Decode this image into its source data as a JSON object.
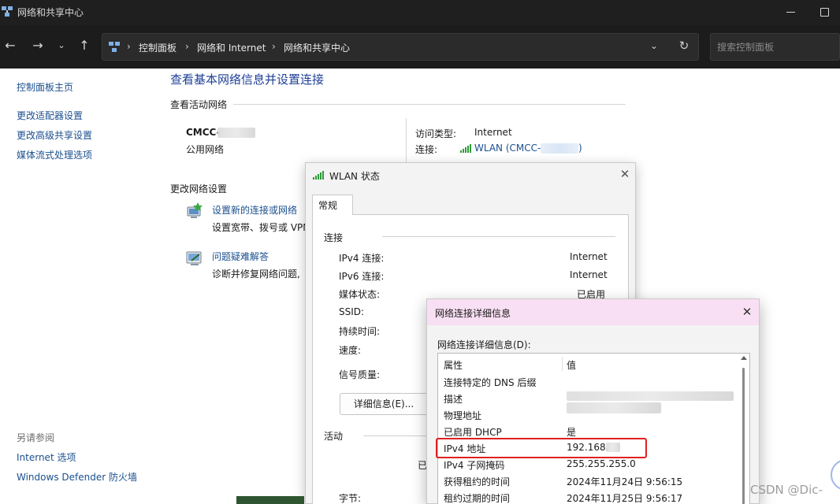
{
  "window": {
    "title": "网络和共享中心"
  },
  "address_bar": {
    "crumbs": [
      "控制面板",
      "网络和 Internet",
      "网络和共享中心"
    ],
    "search_placeholder": "搜索控制面板"
  },
  "sidebar": {
    "links": [
      "控制面板主页",
      "更改适配器设置",
      "更改高级共享设置",
      "媒体流式处理选项"
    ],
    "see_also_title": "另请参阅",
    "see_also_links": [
      "Internet 选项",
      "Windows Defender 防火墙"
    ]
  },
  "main": {
    "title": "查看基本网络信息并设置连接",
    "active_networks_label": "查看活动网络",
    "network_name": "CMCC-",
    "network_type": "公用网络",
    "access_type_label": "访问类型:",
    "access_type_value": "Internet",
    "connections_label": "连接:",
    "connection_link": "WLAN (CMCC-",
    "connection_link_end": ")",
    "change_settings_label": "更改网络设置",
    "tasks": [
      {
        "title": "设置新的连接或网络",
        "desc": "设置宽带、拨号或 VPN"
      },
      {
        "title": "问题疑难解答",
        "desc": "诊断并修复网络问题,"
      }
    ]
  },
  "wlan_dialog": {
    "title": "WLAN 状态",
    "tab": "常规",
    "connection_section": "连接",
    "rows": [
      {
        "label": "IPv4 连接:",
        "value": "Internet"
      },
      {
        "label": "IPv6 连接:",
        "value": "Internet"
      },
      {
        "label": "媒体状态:",
        "value": "已启用"
      },
      {
        "label": "SSID:",
        "value": ""
      },
      {
        "label": "持续时间:",
        "value": ""
      },
      {
        "label": "速度:",
        "value": ""
      }
    ],
    "signal_label": "信号质量:",
    "details_button": "详细信息(E)...",
    "activity_section": "活动",
    "sent_partial": "已",
    "bytes_label": "字节:"
  },
  "details_dialog": {
    "title": "网络连接详细信息",
    "list_label": "网络连接详细信息(D):",
    "col_property": "属性",
    "col_value": "值",
    "rows": [
      {
        "property": "连接特定的 DNS 后缀",
        "value": ""
      },
      {
        "property": "描述",
        "value": ""
      },
      {
        "property": "物理地址",
        "value": ""
      },
      {
        "property": "已启用 DHCP",
        "value": "是"
      },
      {
        "property": "IPv4 地址",
        "value": "192.168."
      },
      {
        "property": "IPv4 子网掩码",
        "value": "255.255.255.0"
      },
      {
        "property": "获得租约的时间",
        "value": "2024年11月24日 9:56:15"
      },
      {
        "property": "租约过期的时间",
        "value": "2024年11月25日 9:56:17"
      }
    ]
  },
  "watermark": "CSDN @Dic-",
  "colors": {
    "link": "#1a4f8f",
    "title_blue": "#1e3f96",
    "dialog_header_pink": "#f9dff3",
    "highlight_red": "#e02020"
  }
}
